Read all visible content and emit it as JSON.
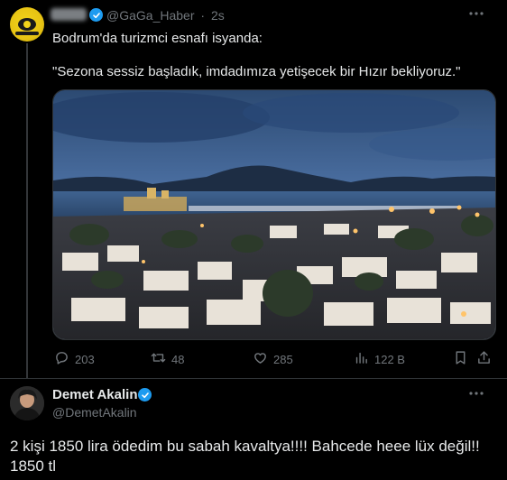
{
  "quoted_tweet": {
    "display_name": "GaGa",
    "handle": "@GaGa_Haber",
    "separator": "·",
    "time": "2s",
    "text_line1": "Bodrum'da turizmci esnafı isyanda:",
    "text_line2": "\"Sezona sessiz başladık, imdadımıza yetişecek bir Hızır bekliyoruz.\"",
    "more_icon": "more-icon",
    "stats": {
      "replies": "203",
      "retweets": "48",
      "likes": "285",
      "views": "122 B"
    }
  },
  "main_tweet": {
    "display_name": "Demet Akalin",
    "handle": "@DemetAkalin",
    "text_line1": "2 kişi 1850 lira ödedim bu sabah kavaltya!!!! Bahcede heee lüx değil!!",
    "text_line2": "1850 tl"
  },
  "colors": {
    "background": "#000000",
    "text": "#e7e9ea",
    "muted": "#71767b",
    "verified": "#1d9bf0",
    "avatar_yellow": "#f2d31b"
  }
}
